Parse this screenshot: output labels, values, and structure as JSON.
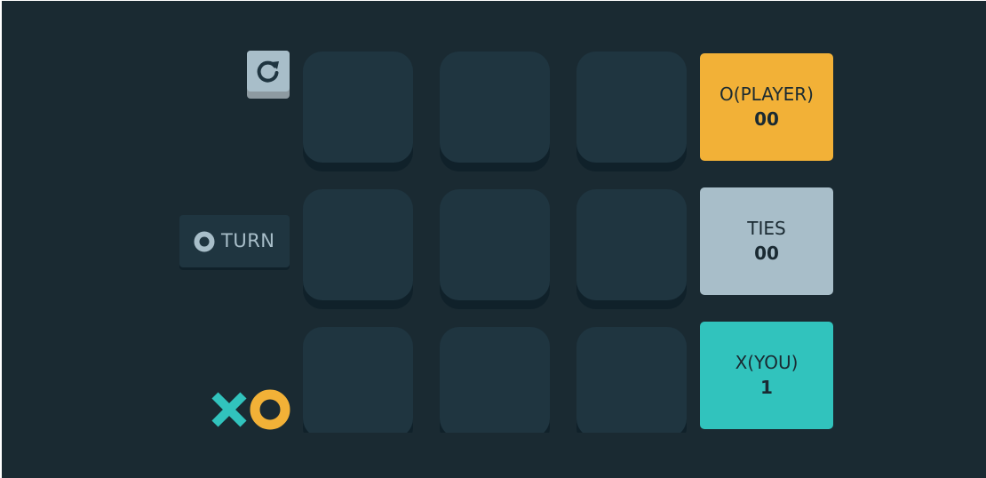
{
  "colors": {
    "background": "#1a2a32",
    "cell": "#1f3540",
    "cell_shadow": "#10212a",
    "x_color": "#31c3bd",
    "o_color": "#f2b137",
    "silver": "#a8bec9"
  },
  "logo": {
    "x_icon": "x-mark-icon",
    "o_icon": "o-mark-icon"
  },
  "restart": {
    "icon": "restart-icon"
  },
  "turn": {
    "mark_icon": "o-mark-icon",
    "label": "TURN"
  },
  "board": {
    "rows": 3,
    "cols": 3,
    "cells": [
      "",
      "",
      "",
      "",
      "",
      "",
      "",
      "",
      ""
    ]
  },
  "scores": {
    "o": {
      "title": "O(PLAYER)",
      "value": "00",
      "color": "#f2b137"
    },
    "ties": {
      "title": "TIES",
      "value": "00",
      "color": "#a8bec9"
    },
    "x": {
      "title": "X(YOU)",
      "value": "1",
      "color": "#31c3bd"
    }
  }
}
